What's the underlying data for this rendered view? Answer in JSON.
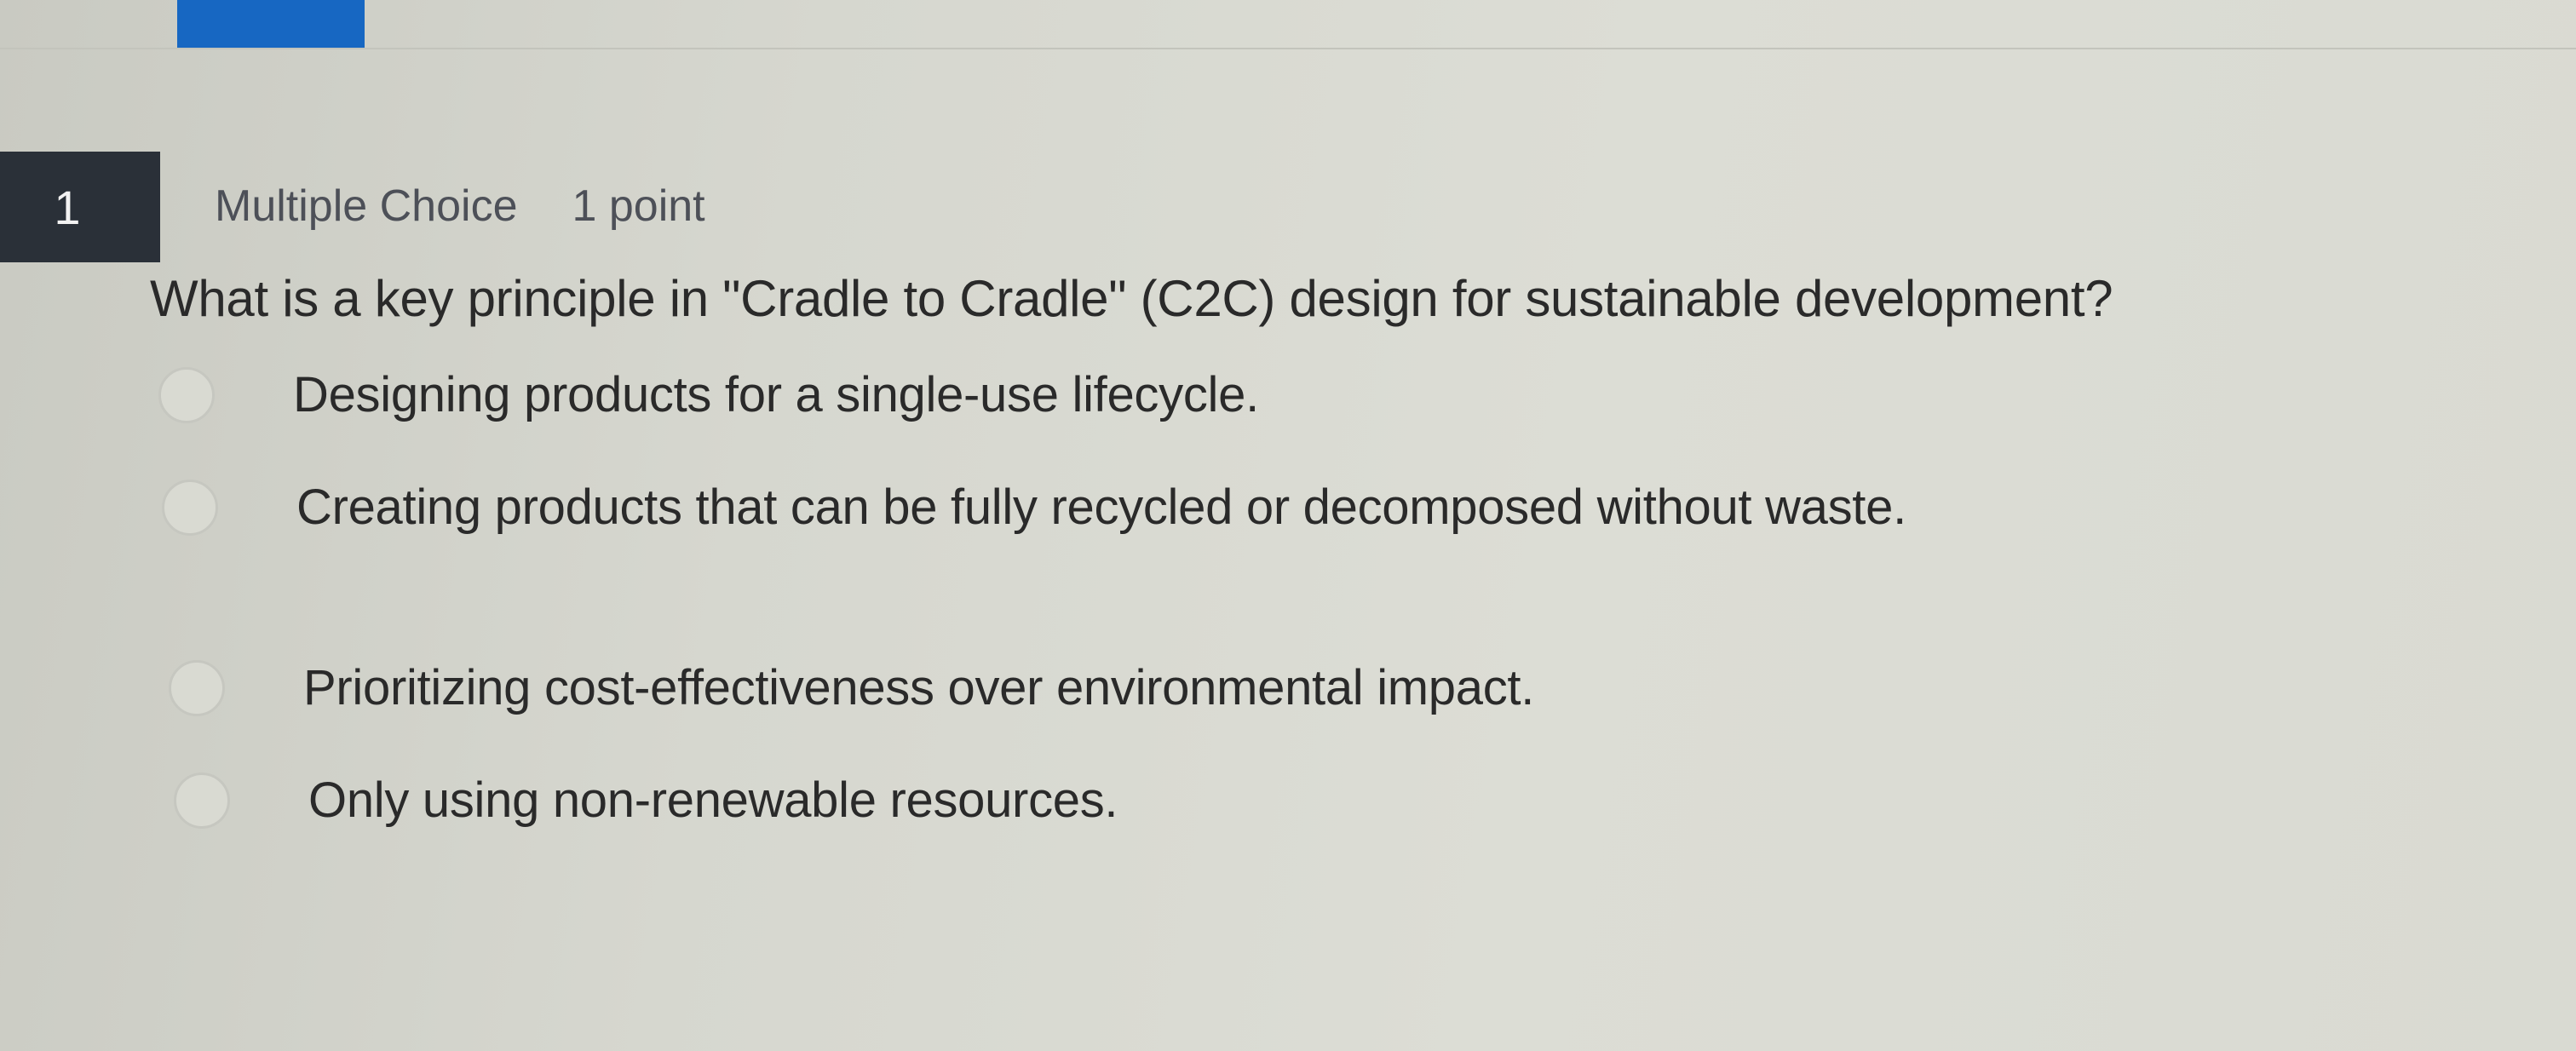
{
  "question": {
    "number": "1",
    "type": "Multiple Choice",
    "points": "1 point",
    "text": "What is a key principle in \"Cradle to Cradle\" (C2C) design for sustainable development?"
  },
  "options": [
    {
      "label": "Designing products for a single-use lifecycle.",
      "selected": false
    },
    {
      "label": "Creating products that can be fully recycled or decomposed without waste.",
      "selected": false
    },
    {
      "label": "Prioritizing cost-effectiveness over environmental impact.",
      "selected": false
    },
    {
      "label": "Only using non-renewable resources.",
      "selected": false
    }
  ],
  "colors": {
    "accent": "#1767c2",
    "number_box": "#2a3038"
  }
}
